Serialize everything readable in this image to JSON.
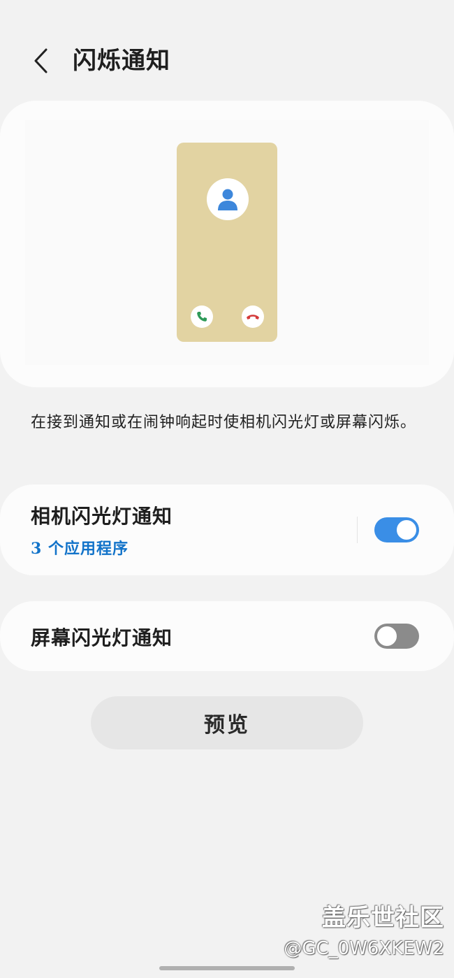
{
  "header": {
    "title": "闪烁通知",
    "back_icon": "chevron-left-icon"
  },
  "illustration": {
    "phone_color": "#e2d3a2",
    "avatar_icon": "person-icon",
    "accept_icon": "phone-accept-icon",
    "decline_icon": "phone-decline-icon"
  },
  "description": "在接到通知或在闹钟响起时使相机闪光灯或屏幕闪烁。",
  "settings": {
    "camera_flash": {
      "title": "相机闪光灯通知",
      "subtitle": "3 个应用程序",
      "enabled": true
    },
    "screen_flash": {
      "title": "屏幕闪光灯通知",
      "enabled": false
    }
  },
  "preview_button": {
    "label": "预览"
  },
  "watermark": {
    "brand": "盖乐世社区",
    "user": "@GC_0W6XKEW2"
  },
  "colors": {
    "accent": "#3a8ee6",
    "link": "#1273c9",
    "background": "#f2f2f2"
  }
}
